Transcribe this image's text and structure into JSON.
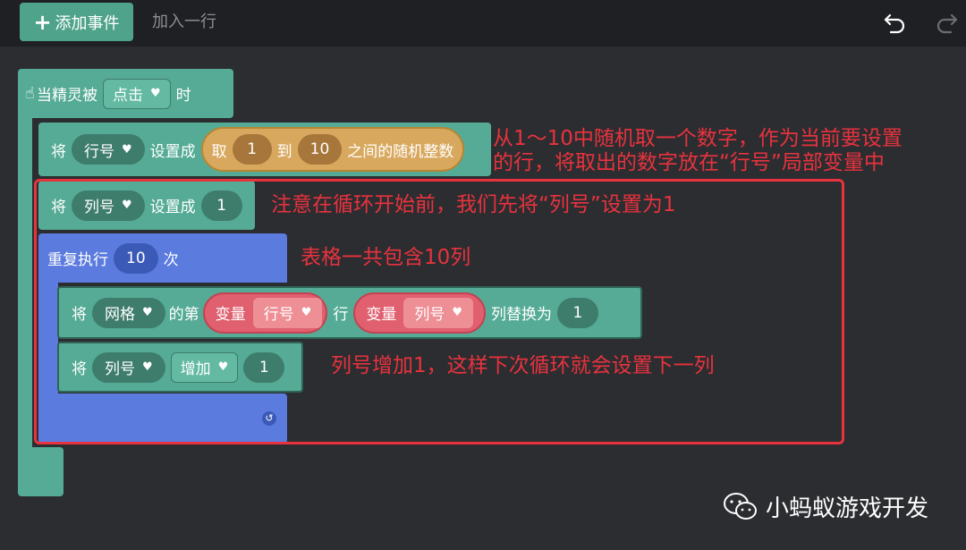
{
  "toolbar": {
    "add_event_label": "添加事件",
    "add_row_label": "加入一行"
  },
  "event_block": {
    "prefix": "当精灵被",
    "event_option": "点击",
    "suffix": "时"
  },
  "block_set_row": {
    "jiang": "将",
    "var": "行号",
    "set_to": "设置成",
    "take": "取",
    "from": "1",
    "to": "到",
    "to_value": "10",
    "between": "之间的随机整数"
  },
  "block_set_col": {
    "jiang": "将",
    "var": "列号",
    "set_to": "设置成",
    "value": "1"
  },
  "repeat_block": {
    "label": "重复执行",
    "count": "10",
    "times": "次"
  },
  "replace_block": {
    "jiang": "将",
    "grid": "网格",
    "of": "的第",
    "var1_label": "变量",
    "var1": "行号",
    "row": "行",
    "var2_label": "变量",
    "var2": "列号",
    "replace": "列替换为",
    "value": "1"
  },
  "increment_block": {
    "jiang": "将",
    "var": "列号",
    "op": "增加",
    "value": "1"
  },
  "annotations": {
    "a1_line1": "从1～10中随机取一个数字，作为当前要设置",
    "a1_line2": "的行，将取出的数字放在“行号”局部变量中",
    "a2": "注意在循环开始前，我们先将“列号”设置为1",
    "a3": "表格一共包含10列",
    "a4": "列号增加1，这样下次循环就会设置下一列"
  },
  "watermark": "小蚂蚁游戏开发",
  "colors": {
    "event_green": "#55ab95",
    "loop_blue": "#5b7bde",
    "random_orange": "#d8a85e",
    "variable_red": "#e0606f",
    "annotation_red": "#e8323e"
  }
}
